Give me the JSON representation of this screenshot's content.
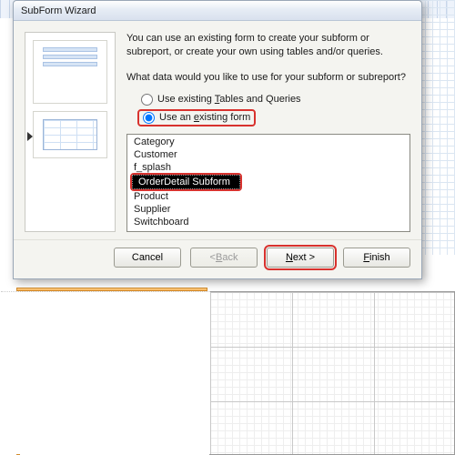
{
  "dialog": {
    "title": "SubForm Wizard",
    "intro": "You can use an existing form to create your subform or subreport, or create your own using tables and/or queries.",
    "question": "What data would you like to use for your subform or subreport?",
    "radio_tables": "Use existing Tables and Queries",
    "radio_tables_accel": "T",
    "radio_form": "Use an existing form",
    "radio_form_accel": "e",
    "selected_radio": "form",
    "forms": [
      "Category",
      "Customer",
      "f_splash",
      "OrderDetail Subform",
      "Product",
      "Supplier",
      "Switchboard"
    ],
    "selected_form_index": 3
  },
  "buttons": {
    "cancel": "Cancel",
    "back": "< Back",
    "next": "Next >",
    "finish": "Finish",
    "back_accel": "B",
    "next_accel": "N",
    "finish_accel": "F"
  },
  "highlight": {
    "color": "#d8322e"
  }
}
